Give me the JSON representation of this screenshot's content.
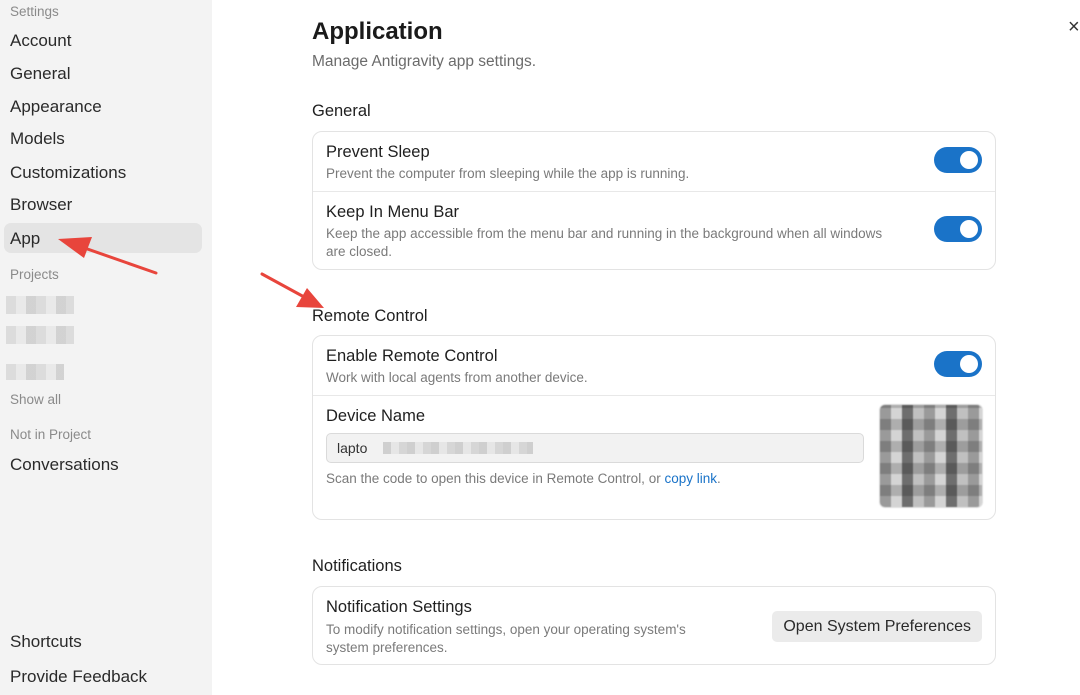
{
  "sidebar": {
    "settings_header": "Settings",
    "items": [
      "Account",
      "General",
      "Appearance",
      "Models",
      "Customizations",
      "Browser",
      "App"
    ],
    "projects_header": "Projects",
    "show_all": "Show all",
    "not_in_project_header": "Not in Project",
    "conversations": "Conversations",
    "shortcuts": "Shortcuts",
    "feedback": "Provide Feedback"
  },
  "page": {
    "title": "Application",
    "subtitle": "Manage Antigravity app settings."
  },
  "general": {
    "heading": "General",
    "prevent_sleep": {
      "title": "Prevent Sleep",
      "desc": "Prevent the computer from sleeping while the app is running.",
      "enabled": true
    },
    "menu_bar": {
      "title": "Keep In Menu Bar",
      "desc_line1": "Keep the app accessible from the menu bar and running in the background when all windows",
      "desc_line2": "are closed.",
      "enabled": true
    }
  },
  "remote": {
    "heading": "Remote Control",
    "enable": {
      "title": "Enable Remote Control",
      "desc": "Work with local agents from another device.",
      "enabled": true
    },
    "device": {
      "title": "Device Name",
      "value": "lapto",
      "scan_text": "Scan the code to open this device in Remote Control, or ",
      "copy_link": "copy link",
      "period": "."
    }
  },
  "notifications": {
    "heading": "Notifications",
    "settings": {
      "title": "Notification Settings",
      "desc_line1": "To modify notification settings, open your operating system's",
      "desc_line2": "system preferences.",
      "button": "Open System Preferences"
    }
  },
  "close_icon": "×",
  "colors": {
    "accent": "#1a73c8",
    "annotation": "#e8453c"
  }
}
